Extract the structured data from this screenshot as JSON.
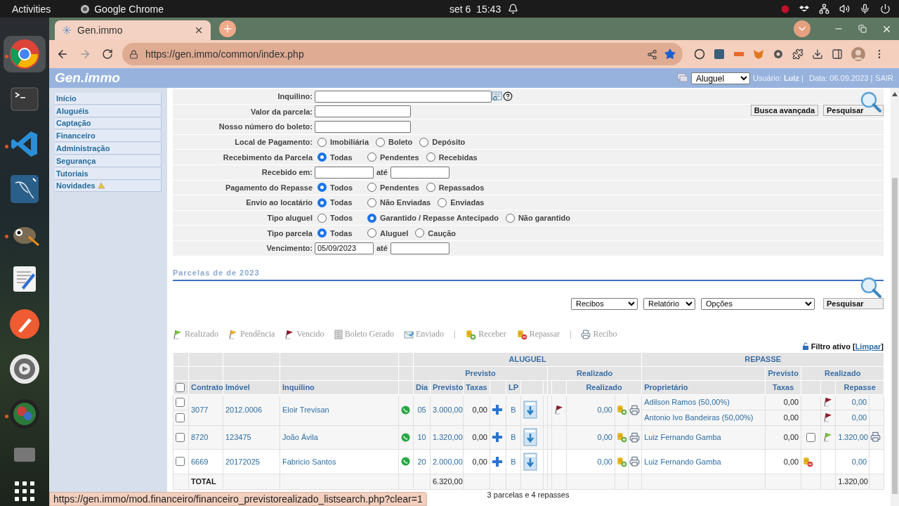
{
  "top_bar": {
    "activities": "Activities",
    "app_name": "Google Chrome",
    "date": "set 6",
    "time": "15:43"
  },
  "dock": [
    {
      "kind": "browser",
      "running": true,
      "selected": true
    },
    {
      "kind": "terminal",
      "running": false,
      "selected": false
    },
    {
      "kind": "code",
      "running": true,
      "selected": false
    },
    {
      "kind": "database",
      "running": false,
      "selected": false
    },
    {
      "kind": "paint",
      "running": true,
      "selected": false
    },
    {
      "kind": "editor",
      "running": false,
      "selected": false
    },
    {
      "kind": "pen",
      "running": false,
      "selected": false
    },
    {
      "kind": "settings",
      "running": false,
      "selected": false
    },
    {
      "kind": "camera",
      "running": true,
      "selected": false
    },
    {
      "kind": "drive",
      "running": false,
      "selected": false
    },
    {
      "kind": "apps",
      "running": false,
      "selected": false
    }
  ],
  "browser": {
    "tab_title": "Gen.immo",
    "url": "https://gen.immo/common/index.php",
    "status_url": "https://gen.immo/mod.financeiro/financeiro_previstorealizado_listsearch.php?clear=1"
  },
  "header": {
    "logo": "Gen.immo",
    "module": "Aluguel",
    "user_info": "Usuário: **Luiz** |",
    "date": "Data: 06.09.2023 |",
    "logout": "SAIR"
  },
  "sidebar": [
    {
      "label": "Início",
      "new": false
    },
    {
      "label": "Aluguéis",
      "new": false
    },
    {
      "label": "Captação",
      "new": false
    },
    {
      "label": "Financeiro",
      "new": false
    },
    {
      "label": "Administração",
      "new": false
    },
    {
      "label": "Segurança",
      "new": false
    },
    {
      "label": "Tutoriais",
      "new": false
    },
    {
      "label": "Novidades",
      "new": true
    }
  ],
  "filters": [
    {
      "kind": "lookup",
      "label": "Inquilino:"
    },
    {
      "kind": "text",
      "label": "Valor da parcela:"
    },
    {
      "kind": "text",
      "label": "Nosso número do boleto:"
    },
    {
      "kind": "radio",
      "label": "Local de Pagamento:",
      "options": [
        {
          "label": "Imobiliária",
          "selected": false
        },
        {
          "label": "Boleto",
          "selected": false
        },
        {
          "label": "Depósito",
          "selected": false
        }
      ]
    },
    {
      "kind": "radio",
      "label": "Recebimento da Parcela",
      "options": [
        {
          "label": "Todas",
          "selected": true
        },
        {
          "label": "Pendentes",
          "selected": false
        },
        {
          "label": "Recebidas",
          "selected": false
        }
      ]
    },
    {
      "kind": "range",
      "label": "Recebido em:",
      "between": "até"
    },
    {
      "kind": "radio",
      "label": "Pagamento do Repasse",
      "options": [
        {
          "label": "Todos",
          "selected": true
        },
        {
          "label": "Pendentes",
          "selected": false
        },
        {
          "label": "Repassados",
          "selected": false
        }
      ]
    },
    {
      "kind": "radio",
      "label": "Envio ao locatário",
      "options": [
        {
          "label": "Todas",
          "selected": true
        },
        {
          "label": "Não Enviadas",
          "selected": false
        },
        {
          "label": "Enviadas",
          "selected": false
        }
      ]
    },
    {
      "kind": "radio",
      "label": "Tipo aluguel",
      "options": [
        {
          "label": "Todos",
          "selected": false
        },
        {
          "label": "Garantido / Repasse Antecipado",
          "selected": true
        },
        {
          "label": "Não garantido",
          "selected": false
        }
      ]
    },
    {
      "kind": "radio",
      "label": "Tipo parcela",
      "options": [
        {
          "label": "Todas",
          "selected": true
        },
        {
          "label": "Aluguel",
          "selected": false
        },
        {
          "label": "Caução",
          "selected": false
        }
      ]
    },
    {
      "kind": "range",
      "label": "Vencimento:",
      "from": "05/09/2023",
      "between": "até"
    }
  ],
  "search_actions": [
    "Busca avançada",
    "Pesquisar"
  ],
  "results": {
    "title": "Parcelas de de 2023",
    "selects": [
      "Recibos",
      "Relatório",
      "Opções"
    ],
    "search": "Pesquisar",
    "legend": [
      {
        "kind": "flag",
        "color": "#7cc142",
        "label": "Realizado"
      },
      {
        "kind": "flag",
        "color": "#f0b030",
        "label": "Pendência"
      },
      {
        "kind": "flag",
        "color": "#8c1c2c",
        "label": "Vencido"
      },
      {
        "kind": "boleto",
        "label": "Boleto Gerado"
      },
      {
        "kind": "sent",
        "label": "Enviado"
      },
      {
        "kind": "separator",
        "label": "|"
      },
      {
        "kind": "receive",
        "label": "Receber"
      },
      {
        "kind": "transfer",
        "label": "Repassar"
      },
      {
        "kind": "separator",
        "label": "|"
      },
      {
        "kind": "print",
        "label": "Recibo"
      }
    ],
    "filter": {
      "label": "Filtro ativo [",
      "link": "Limpar",
      "close": "]"
    }
  },
  "table": {
    "all_checked": false,
    "groups": [
      "ALUGUEL",
      "REPASSE"
    ],
    "subgroups": [
      "Previsto",
      "Realizado",
      "Previsto",
      "Realizado"
    ],
    "columns": [
      "Contrato",
      "Imóvel",
      "Inquilino",
      "Dia",
      "Previsto",
      "Taxas",
      "LP",
      "Realizado",
      "Proprietário",
      "Taxas",
      "Repasse"
    ],
    "rows": [
      {
        "contrato": "3077",
        "imovel": "2012.0006",
        "inquilino": "Eloir Trevisan",
        "dia": "05",
        "previsto": "3.000,00",
        "taxas": "0,00",
        "lp": "B",
        "color": "#8c1c2c",
        "realizado": "0,00",
        "repasses": [
          {
            "kind": "plain",
            "checked": false,
            "proprietario": "Adilson Ramos (50,00%)",
            "taxas": "0,00",
            "color": "#8c1c2c",
            "repasse": "0,00",
            "receipt": false
          },
          {
            "kind": "plain",
            "checked": false,
            "proprietario": "Antonio Ivo Bandeiras (50,00%)",
            "taxas": "0,00",
            "color": "#8c1c2c",
            "repasse": "0,00",
            "receipt": false
          }
        ]
      },
      {
        "contrato": "8720",
        "imovel": "123475",
        "inquilino": "João Ávila",
        "dia": "10",
        "previsto": "1.320,00",
        "taxas": "0,00",
        "lp": "B",
        "realizado": "0,00",
        "repasses": [
          {
            "kind": "checkbox",
            "checked": false,
            "proprietario": "Luiz Fernando Gamba",
            "taxas": "0,00",
            "action_checked": false,
            "color": "#7cc142",
            "repasse": "1.320,00",
            "receipt": true
          }
        ]
      },
      {
        "contrato": "6669",
        "imovel": "20172025",
        "inquilino": "Fabricio Santos",
        "dia": "20",
        "previsto": "2.000,00",
        "taxas": "0,00",
        "lp": "B",
        "realizado": "0,00",
        "repasses": [
          {
            "kind": "transfer",
            "checked": false,
            "proprietario": "Luiz Fernando Gamba",
            "taxas": "0,00",
            "repasse": "0,00",
            "receipt": false
          }
        ]
      }
    ],
    "total": {
      "label": "TOTAL",
      "previsto": "6.320,00",
      "repasse": "1.320,00"
    },
    "summary": "3 parcelas e 4 repasses"
  }
}
